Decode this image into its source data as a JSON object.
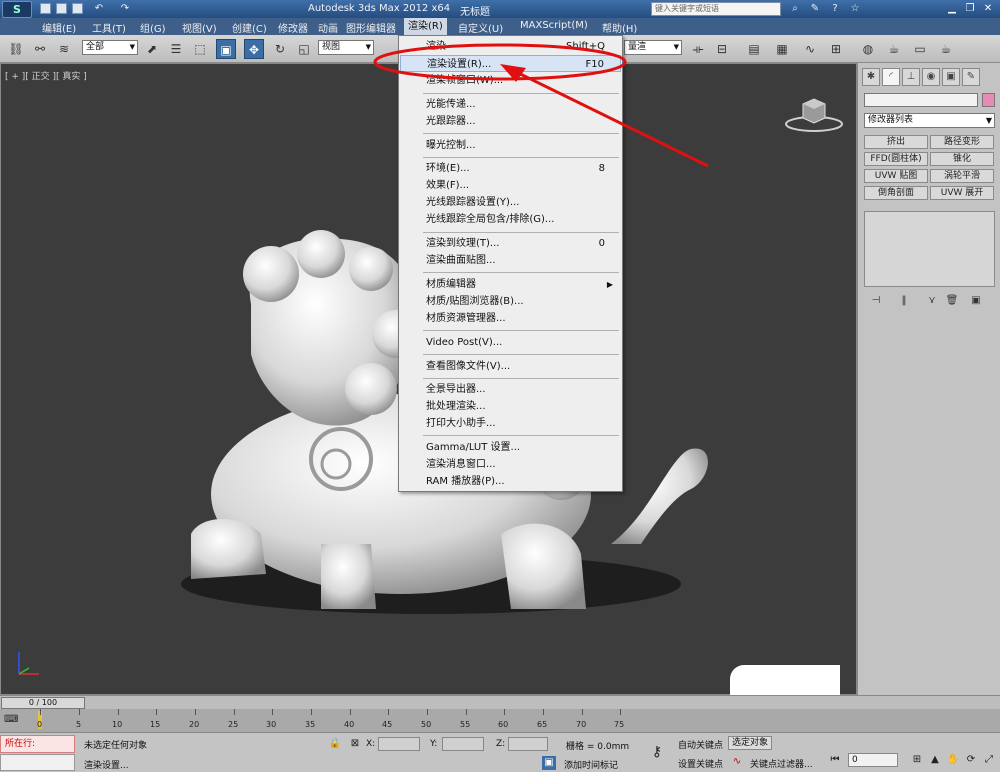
{
  "titlebar": {
    "title": "Autodesk 3ds Max  2012 x64",
    "subtitle": "无标题",
    "search_placeholder": "键入关键字或短语",
    "window_buttons": [
      "▁",
      "❐",
      "✕"
    ]
  },
  "menubar": {
    "items": [
      "编辑(E)",
      "工具(T)",
      "组(G)",
      "视图(V)",
      "创建(C)",
      "修改器",
      "动画",
      "图形编辑器",
      "渲染(R)",
      "自定义(U)",
      "MAXScript(M)",
      "帮助(H)"
    ],
    "active": "渲染(R)"
  },
  "toolbar": {
    "filter_select": "全部",
    "coord_select": "视图",
    "right_select": "量渲"
  },
  "viewport": {
    "label": "[ + ][ 正交 ][ 真实 ]"
  },
  "render_menu": {
    "items": [
      {
        "label": "渲染",
        "key": "Shift+Q"
      },
      {
        "label": "渲染设置(R)...",
        "key": "F10",
        "highlighted": true
      },
      {
        "label": "渲染帧窗口(W)...",
        "key": ""
      },
      {
        "label": "光能传递...",
        "key": ""
      },
      {
        "label": "光跟踪器...",
        "key": ""
      },
      {
        "label": "曝光控制...",
        "key": ""
      },
      {
        "label": "环境(E)...",
        "key": "8"
      },
      {
        "label": "效果(F)...",
        "key": ""
      },
      {
        "label": "光线跟踪器设置(Y)...",
        "key": ""
      },
      {
        "label": "光线跟踪全局包含/排除(G)...",
        "key": ""
      },
      {
        "label": "渲染到纹理(T)...",
        "key": "0"
      },
      {
        "label": "渲染曲面贴图...",
        "key": ""
      },
      {
        "label": "材质编辑器",
        "key": "",
        "submenu": true
      },
      {
        "label": "材质/贴图浏览器(B)...",
        "key": ""
      },
      {
        "label": "材质资源管理器...",
        "key": ""
      },
      {
        "label": "Video Post(V)...",
        "key": ""
      },
      {
        "label": "查看图像文件(V)...",
        "key": ""
      },
      {
        "label": "全景导出器...",
        "key": ""
      },
      {
        "label": "批处理渲染...",
        "key": ""
      },
      {
        "label": "打印大小助手...",
        "key": ""
      },
      {
        "label": "Gamma/LUT 设置...",
        "key": ""
      },
      {
        "label": "渲染消息窗口...",
        "key": ""
      },
      {
        "label": "RAM 播放器(P)...",
        "key": ""
      }
    ]
  },
  "command_panel": {
    "modifier_list": "修改器列表",
    "buttons": [
      "挤出",
      "路径变形",
      "FFD(圆柱体)",
      "锥化",
      "UVW 贴图",
      "涡轮平滑",
      "倒角剖面",
      "UVW 展开"
    ]
  },
  "timeline": {
    "frame_readout": "0 / 100",
    "ticks": [
      "0",
      "5",
      "10",
      "15",
      "20",
      "25",
      "30",
      "35",
      "40",
      "45",
      "50",
      "55",
      "60",
      "65",
      "70",
      "75"
    ]
  },
  "statusbar": {
    "maxscript_label": "所在行:",
    "selection_status": "未选定任何对象",
    "prompt": "渲染设置...",
    "x_label": "X:",
    "y_label": "Y:",
    "z_label": "Z:",
    "grid": "栅格 = 0.0mm",
    "add_time_tag": "添加时间标记",
    "auto_key": "自动关键点",
    "selected_label": "选定对象",
    "set_key": "设置关键点",
    "key_filters": "关键点过滤器...",
    "frame_field": "0"
  },
  "colors": {
    "title_bar": "#2f5c96",
    "menu_bar": "#3e5f8a",
    "viewport_bg": "#3c3c3c",
    "annotation": "#e01010",
    "highlight": "#d6e4f5"
  }
}
